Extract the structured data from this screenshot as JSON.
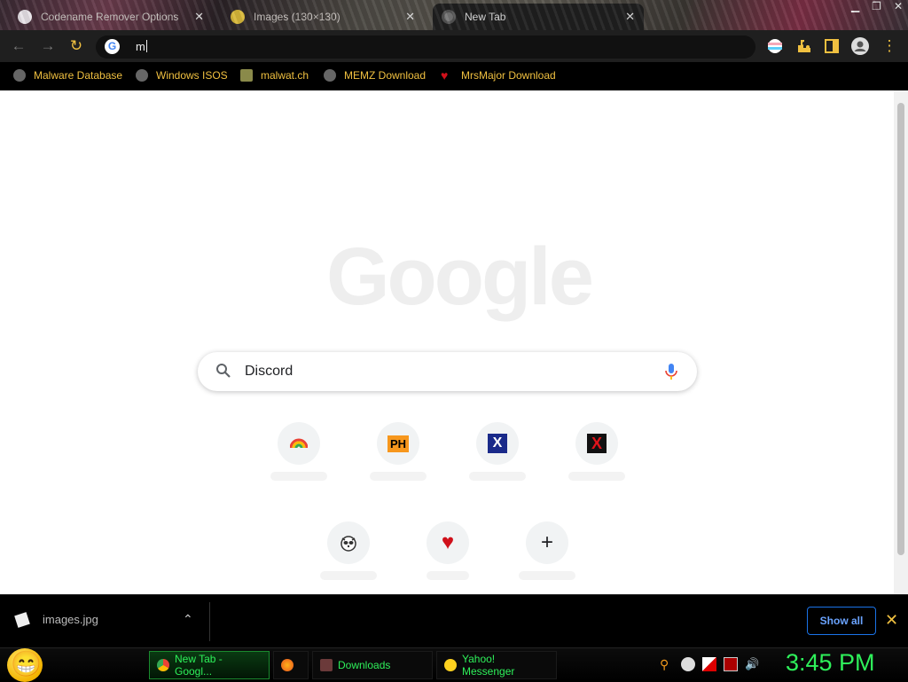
{
  "tabs": [
    {
      "title": "Codename Remover Options",
      "active": false
    },
    {
      "title": "Images (130×130)",
      "active": false
    },
    {
      "title": "New Tab",
      "active": true
    }
  ],
  "omnibox": {
    "value": "m"
  },
  "bookmarks": [
    {
      "label": "Malware Database",
      "icon": "globe-icon"
    },
    {
      "label": "Windows ISOS",
      "icon": "globe-icon"
    },
    {
      "label": "malwat.ch",
      "icon": "person-icon"
    },
    {
      "label": "MEMZ Download",
      "icon": "globe-icon"
    },
    {
      "label": "MrsMajor Download",
      "icon": "heart-icon"
    }
  ],
  "page": {
    "logo": "Google",
    "search_value": "Discord",
    "shortcuts": [
      {
        "icon": "chrome-rainbow-icon",
        "glyph": ""
      },
      {
        "icon": "ph-icon",
        "glyph": "PH"
      },
      {
        "icon": "x-blue-icon",
        "glyph": "X"
      },
      {
        "icon": "x-red-icon",
        "glyph": "X"
      },
      {
        "icon": "raccoon-icon",
        "glyph": ""
      },
      {
        "icon": "heart-icon",
        "glyph": "♥"
      },
      {
        "icon": "add-shortcut-icon",
        "glyph": "+"
      }
    ]
  },
  "downloads": {
    "file": "images.jpg",
    "show_all": "Show all"
  },
  "taskbar": {
    "tasks": [
      {
        "label": "New Tab - Googl...",
        "active": true
      },
      {
        "label": "",
        "active": false
      },
      {
        "label": "Downloads",
        "active": false
      },
      {
        "label": "Yahoo! Messenger",
        "active": false
      }
    ],
    "clock": "3:45 PM"
  },
  "colors": {
    "bookmark_text": "#f0c040",
    "taskbar_text": "#2ef05a",
    "show_all_border": "#1a73e8"
  }
}
